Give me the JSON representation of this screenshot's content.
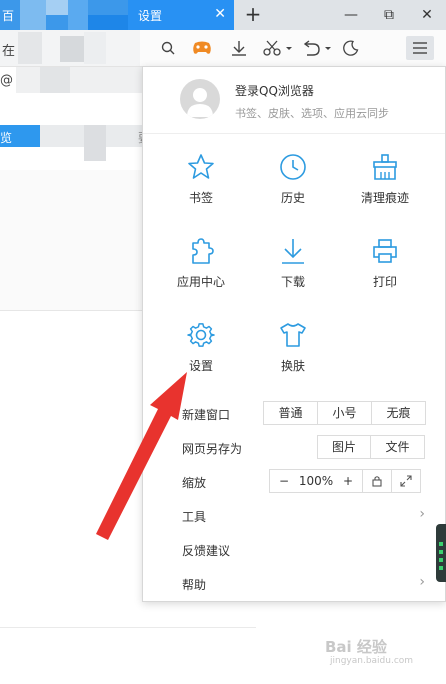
{
  "tabs": {
    "inactive_label": "百",
    "active_label": "设置",
    "close_glyph": "✕",
    "new_tab_glyph": "+"
  },
  "window": {
    "minimize": "—",
    "restore": "⧉",
    "close": "✕"
  },
  "page": {
    "text_1": "在",
    "text_2": "@",
    "text_3": "览",
    "text_4": "要"
  },
  "menu": {
    "login_title": "登录QQ浏览器",
    "login_subtitle": "书签、皮肤、选项、应用云同步",
    "grid": [
      {
        "label": "书签",
        "icon": "star-icon"
      },
      {
        "label": "历史",
        "icon": "clock-icon"
      },
      {
        "label": "清理痕迹",
        "icon": "broom-icon"
      },
      {
        "label": "应用中心",
        "icon": "puzzle-icon"
      },
      {
        "label": "下载",
        "icon": "download-icon"
      },
      {
        "label": "打印",
        "icon": "printer-icon"
      },
      {
        "label": "设置",
        "icon": "gear-icon"
      },
      {
        "label": "换肤",
        "icon": "tshirt-icon"
      }
    ],
    "new_window": {
      "label": "新建窗口",
      "options": [
        "普通",
        "小号",
        "无痕"
      ]
    },
    "save_as": {
      "label": "网页另存为",
      "options": [
        "图片",
        "文件"
      ]
    },
    "zoom": {
      "label": "缩放",
      "minus": "−",
      "value": "100%",
      "plus": "+"
    },
    "tools": {
      "label": "工具",
      "chevron": "›"
    },
    "feedback": {
      "label": "反馈建议"
    },
    "help": {
      "label": "帮助",
      "chevron": "›"
    }
  },
  "watermark": {
    "main": "Bai 经验",
    "sub": "jingyan.baidu.com"
  },
  "colors": {
    "accent": "#2d9be0",
    "tab_active": "#2891f3",
    "arrow": "#e8332e"
  }
}
